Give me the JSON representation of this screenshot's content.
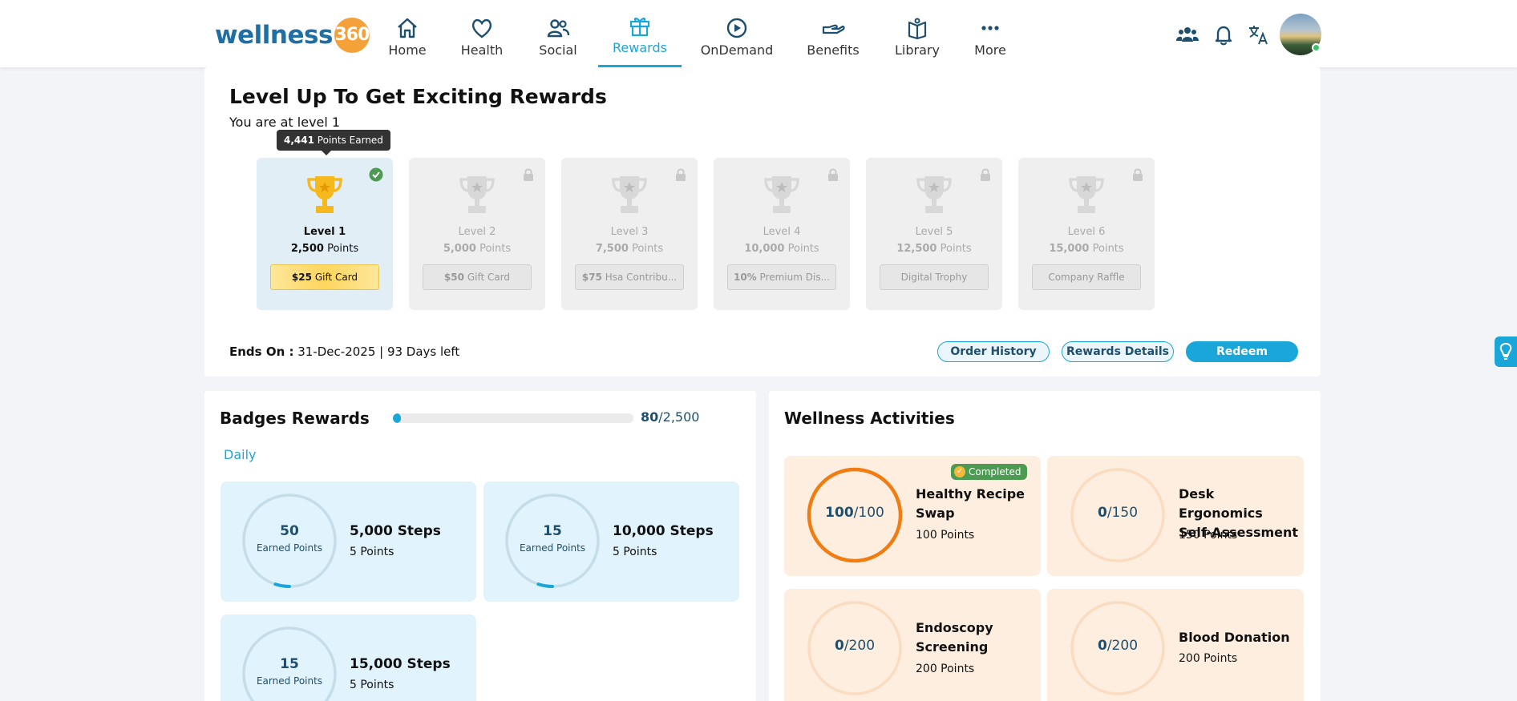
{
  "brand": {
    "logo_text": "wellness",
    "logo_num": "360"
  },
  "nav": [
    {
      "label": "Home",
      "icon": "home-icon"
    },
    {
      "label": "Health",
      "icon": "heart-icon"
    },
    {
      "label": "Social",
      "icon": "people-icon"
    },
    {
      "label": "Rewards",
      "icon": "gift-icon",
      "active": true
    },
    {
      "label": "OnDemand",
      "icon": "play-circle-icon"
    },
    {
      "label": "Benefits",
      "icon": "hand-icon"
    },
    {
      "label": "Library",
      "icon": "book-icon"
    },
    {
      "label": "More",
      "icon": "more-dots-icon"
    }
  ],
  "header_icons": [
    "group-icon",
    "bell-icon",
    "translate-icon",
    "avatar"
  ],
  "levels_section": {
    "title": "Level Up To Get Exciting Rewards",
    "subtitle": "You are at level 1",
    "tooltip_value": "4,441",
    "tooltip_label": "Points Earned",
    "levels": [
      {
        "name": "Level 1",
        "points_value": "2,500",
        "points_unit": "Points",
        "reward_value": "$25",
        "reward_label": "Gift Card",
        "unlocked": true
      },
      {
        "name": "Level 2",
        "points_value": "5,000",
        "points_unit": "Points",
        "reward_value": "$50",
        "reward_label": "Gift Card",
        "unlocked": false
      },
      {
        "name": "Level 3",
        "points_value": "7,500",
        "points_unit": "Points",
        "reward_value": "$75",
        "reward_label": "Hsa Contribu...",
        "unlocked": false
      },
      {
        "name": "Level 4",
        "points_value": "10,000",
        "points_unit": "Points",
        "reward_value": "10%",
        "reward_label": "Premium Dis...",
        "unlocked": false
      },
      {
        "name": "Level 5",
        "points_value": "12,500",
        "points_unit": "Points",
        "reward_value": "",
        "reward_label": "Digital Trophy",
        "unlocked": false
      },
      {
        "name": "Level 6",
        "points_value": "15,000",
        "points_unit": "Points",
        "reward_value": "",
        "reward_label": "Company Raffle",
        "unlocked": false
      }
    ],
    "ends_label": "Ends On :",
    "ends_value": "31-Dec-2025 | 93 Days left",
    "buttons": {
      "order_history": "Order History",
      "rewards_details": "Rewards Details",
      "redeem": "Redeem"
    }
  },
  "badges": {
    "title": "Badges Rewards",
    "progress_current": "80",
    "progress_total": "/2,500",
    "progress_fraction": 0.032,
    "tab": "Daily",
    "cards": [
      {
        "earned": "50",
        "earned_label": "Earned Points",
        "title": "5,000 Steps",
        "points": "5 Points",
        "progress": 0.1
      },
      {
        "earned": "15",
        "earned_label": "Earned Points",
        "title": "10,000 Steps",
        "points": "5 Points",
        "progress": 0.1
      },
      {
        "earned": "15",
        "earned_label": "Earned Points",
        "title": "15,000 Steps",
        "points": "5 Points",
        "progress": 0.1
      }
    ]
  },
  "activities": {
    "title": "Wellness Activities",
    "cards": [
      {
        "earned": "100",
        "total": "/100",
        "title": "Healthy Recipe Swap",
        "points": "100 Points",
        "completed_label": "Completed",
        "progress": 1
      },
      {
        "earned": "0",
        "total": "/150",
        "title": "Desk Ergonomics Self-Assessment",
        "points": "150 Points",
        "progress": 0
      },
      {
        "earned": "0",
        "total": "/200",
        "title": "Endoscopy Screening",
        "points": "200 Points",
        "progress": 0
      },
      {
        "earned": "0",
        "total": "/200",
        "title": "Blood Donation",
        "points": "200 Points",
        "progress": 0
      }
    ]
  },
  "colors": {
    "accent": "#1ba6d9",
    "navy": "#1e4f6e",
    "orange": "#f07c12",
    "gold": "#f5b91d",
    "green": "#4d9a52"
  }
}
